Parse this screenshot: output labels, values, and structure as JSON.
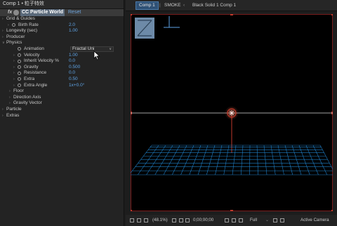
{
  "effect_controls": {
    "title": "Comp 1 • 粒子特效",
    "fx_label": "fx",
    "effect_name": "CC Particle World",
    "reset_label": "Reset",
    "rows": [
      {
        "label": "Grid & Guides",
        "value": "",
        "indent": 0,
        "twirl": ">",
        "stopwatch": false
      },
      {
        "label": "Birth Rate",
        "value": "2.0",
        "indent": 1,
        "twirl": ">",
        "stopwatch": true
      },
      {
        "label": "Longevity (sec)",
        "value": "1.00",
        "indent": 0,
        "twirl": ">",
        "stopwatch": false
      },
      {
        "label": "Producer",
        "value": "",
        "indent": 0,
        "twirl": ">",
        "stopwatch": false
      },
      {
        "label": "Physics",
        "value": "",
        "indent": 0,
        "twirl": "v",
        "stopwatch": false
      },
      {
        "label": "Animation",
        "value": "",
        "indent": 2,
        "twirl": "",
        "stopwatch": true
      },
      {
        "label": "Velocity",
        "value": "1.00",
        "indent": 2,
        "twirl": ">",
        "stopwatch": true
      },
      {
        "label": "Inherit Velocity %",
        "value": "0.0",
        "indent": 2,
        "twirl": ">",
        "stopwatch": true
      },
      {
        "label": "Gravity",
        "value": "0.500",
        "indent": 2,
        "twirl": ">",
        "stopwatch": true
      },
      {
        "label": "Resistance",
        "value": "0.0",
        "indent": 2,
        "twirl": ">",
        "stopwatch": true
      },
      {
        "label": "Extra",
        "value": "0.50",
        "indent": 2,
        "twirl": ">",
        "stopwatch": true
      },
      {
        "label": "Extra Angle",
        "value": "1x+0.0°",
        "indent": 2,
        "twirl": ">",
        "stopwatch": true
      },
      {
        "label": "Floor",
        "value": "",
        "indent": 3,
        "twirl": ">",
        "stopwatch": false
      },
      {
        "label": "Direction Axis",
        "value": "",
        "indent": 3,
        "twirl": ">",
        "stopwatch": false
      },
      {
        "label": "Gravity Vector",
        "value": "",
        "indent": 3,
        "twirl": ">",
        "stopwatch": false
      },
      {
        "label": "Particle",
        "value": "",
        "indent": 0,
        "twirl": ">",
        "stopwatch": false
      },
      {
        "label": "Extras",
        "value": "",
        "indent": 0,
        "twirl": ">",
        "stopwatch": false
      }
    ],
    "animation_dropdown": "Fractal Uni"
  },
  "composition": {
    "tabs": [
      "Comp 1",
      "SMOKE",
      "Black Solid 1 Comp 1"
    ],
    "status": {
      "zoom": "(48.1%)",
      "timecode": "0;00;00;00",
      "resolution": "Full",
      "camera": "Active Camera"
    }
  },
  "colors": {
    "accent": "#2f5175",
    "param_value": "#5fa5e8",
    "grid": "#1f7fc6",
    "handle": "#c0392b"
  }
}
